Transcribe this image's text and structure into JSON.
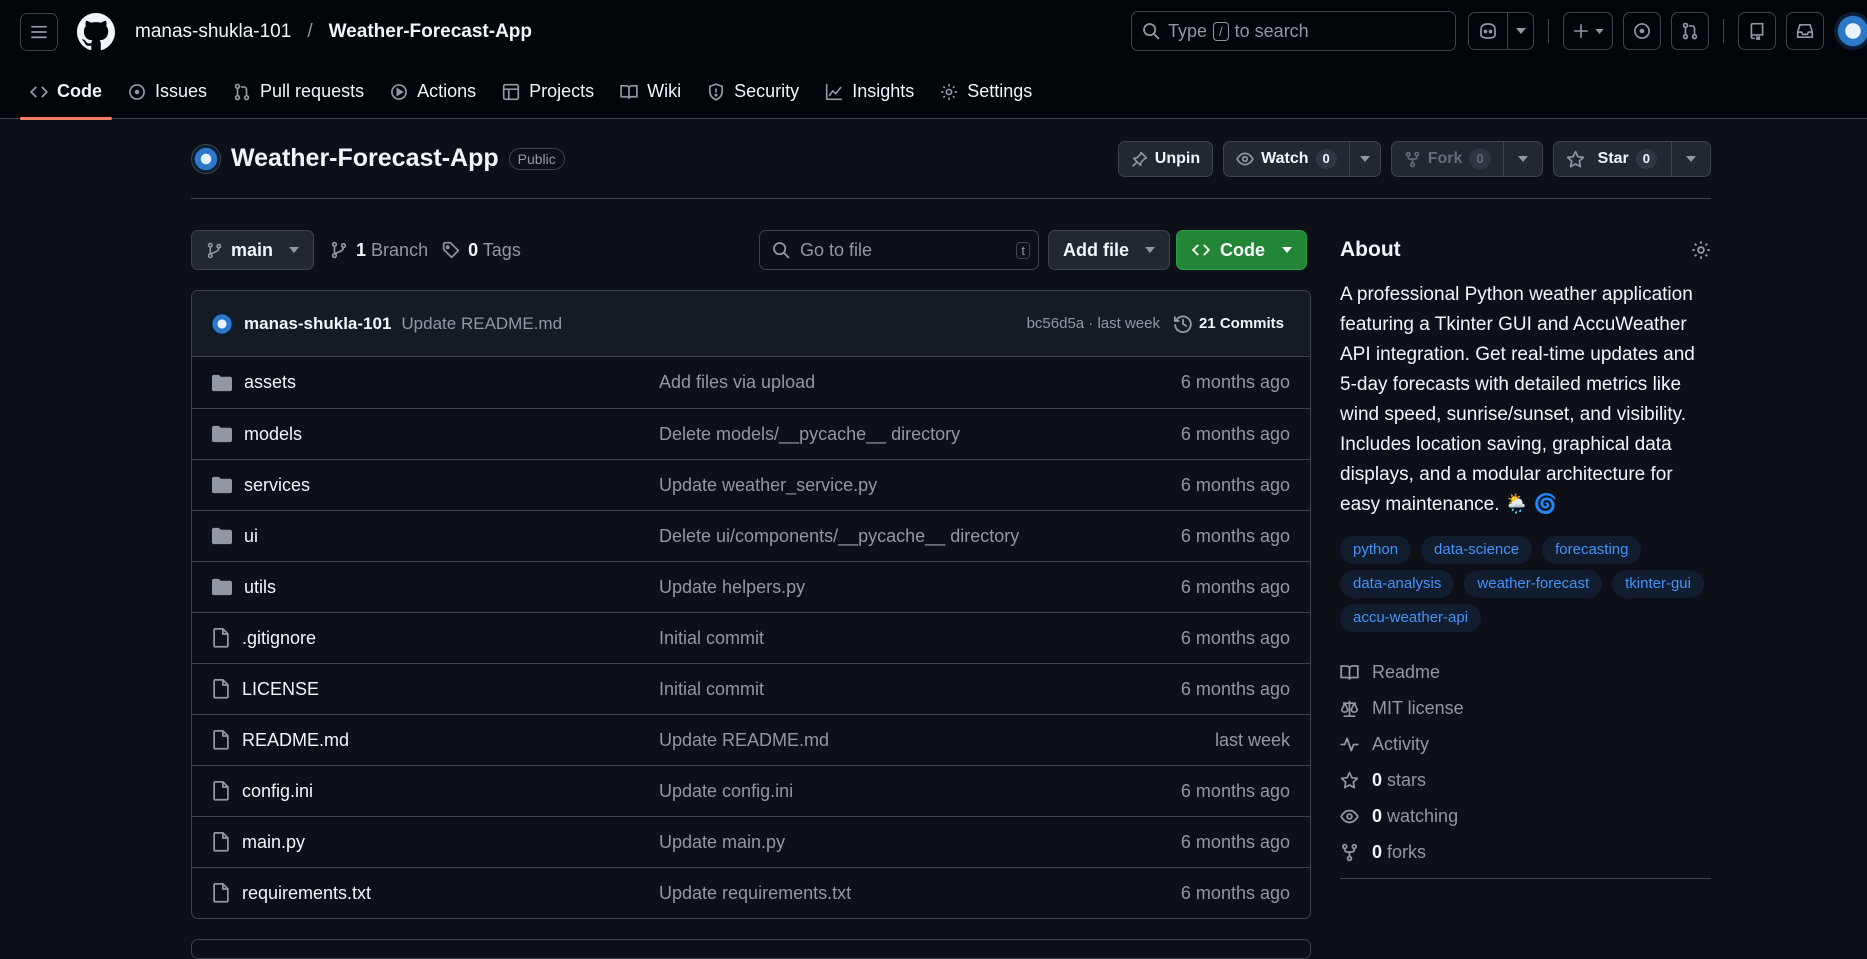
{
  "header": {
    "owner": "manas-shukla-101",
    "separator": "/",
    "repo": "Weather-Forecast-App",
    "search_pre": "Type",
    "search_key": "/",
    "search_post": "to search"
  },
  "tabs": [
    {
      "label": "Code",
      "icon": "code-icon"
    },
    {
      "label": "Issues",
      "icon": "issue-icon"
    },
    {
      "label": "Pull requests",
      "icon": "pull-request-icon"
    },
    {
      "label": "Actions",
      "icon": "play-icon"
    },
    {
      "label": "Projects",
      "icon": "table-icon"
    },
    {
      "label": "Wiki",
      "icon": "book-icon"
    },
    {
      "label": "Security",
      "icon": "shield-icon"
    },
    {
      "label": "Insights",
      "icon": "graph-icon"
    },
    {
      "label": "Settings",
      "icon": "gear-icon"
    }
  ],
  "repo_header": {
    "title": "Weather-Forecast-App",
    "visibility": "Public",
    "unpin": "Unpin",
    "watch": "Watch",
    "watch_count": "0",
    "fork": "Fork",
    "fork_count": "0",
    "star": "Star",
    "star_count": "0"
  },
  "toolbar": {
    "branch": "main",
    "branches_count": "1",
    "branches_label": "Branch",
    "tags_count": "0",
    "tags_label": "Tags",
    "goto_placeholder": "Go to file",
    "goto_key": "t",
    "add_file": "Add file",
    "code": "Code"
  },
  "latest_commit": {
    "author": "manas-shukla-101",
    "message": "Update README.md",
    "meta": "bc56d5a · last week",
    "commits": "21 Commits"
  },
  "files": [
    {
      "name": "assets",
      "type": "folder",
      "message": "Add files via upload",
      "date": "6 months ago"
    },
    {
      "name": "models",
      "type": "folder",
      "message": "Delete models/__pycache__ directory",
      "date": "6 months ago"
    },
    {
      "name": "services",
      "type": "folder",
      "message": "Update weather_service.py",
      "date": "6 months ago"
    },
    {
      "name": "ui",
      "type": "folder",
      "message": "Delete ui/components/__pycache__ directory",
      "date": "6 months ago"
    },
    {
      "name": "utils",
      "type": "folder",
      "message": "Update helpers.py",
      "date": "6 months ago"
    },
    {
      "name": ".gitignore",
      "type": "file",
      "message": "Initial commit",
      "date": "6 months ago"
    },
    {
      "name": "LICENSE",
      "type": "file",
      "message": "Initial commit",
      "date": "6 months ago"
    },
    {
      "name": "README.md",
      "type": "file",
      "message": "Update README.md",
      "date": "last week"
    },
    {
      "name": "config.ini",
      "type": "file",
      "message": "Update config.ini",
      "date": "6 months ago"
    },
    {
      "name": "main.py",
      "type": "file",
      "message": "Update main.py",
      "date": "6 months ago"
    },
    {
      "name": "requirements.txt",
      "type": "file",
      "message": "Update requirements.txt",
      "date": "6 months ago"
    }
  ],
  "about": {
    "title": "About",
    "description": "A professional Python weather application featuring a Tkinter GUI and AccuWeather API integration. Get real-time updates and 5-day forecasts with detailed metrics like wind speed, sunrise/sunset, and visibility. Includes location saving, graphical data displays, and a modular architecture for easy maintenance. 🌦️ 🌀",
    "topics": [
      "python",
      "data-science",
      "forecasting",
      "data-analysis",
      "weather-forecast",
      "tkinter-gui",
      "accu-weather-api"
    ],
    "readme": "Readme",
    "license": "MIT license",
    "activity": "Activity",
    "stars_count": "0",
    "stars_label": "stars",
    "watching_count": "0",
    "watching_label": "watching",
    "forks_count": "0",
    "forks_label": "forks"
  },
  "colors": {
    "background": "#0d1117",
    "accent_tab": "#f78166",
    "primary_button": "#238636",
    "link": "#4493f8"
  }
}
